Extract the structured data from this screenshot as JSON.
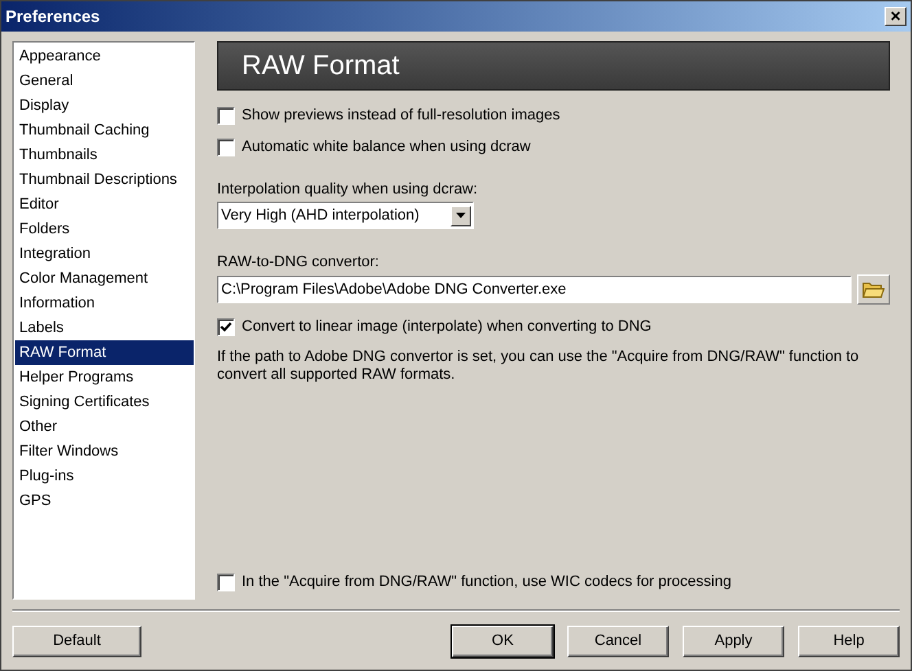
{
  "window": {
    "title": "Preferences",
    "close": "×"
  },
  "categories": [
    {
      "label": "Appearance",
      "selected": false
    },
    {
      "label": "General",
      "selected": false
    },
    {
      "label": "Display",
      "selected": false
    },
    {
      "label": "Thumbnail Caching",
      "selected": false
    },
    {
      "label": "Thumbnails",
      "selected": false
    },
    {
      "label": "Thumbnail Descriptions",
      "selected": false
    },
    {
      "label": "Editor",
      "selected": false
    },
    {
      "label": "Folders",
      "selected": false
    },
    {
      "label": "Integration",
      "selected": false
    },
    {
      "label": "Color Management",
      "selected": false
    },
    {
      "label": "Information",
      "selected": false
    },
    {
      "label": "Labels",
      "selected": false
    },
    {
      "label": "RAW Format",
      "selected": true
    },
    {
      "label": "Helper Programs",
      "selected": false
    },
    {
      "label": "Signing Certificates",
      "selected": false
    },
    {
      "label": "Other",
      "selected": false
    },
    {
      "label": "Filter Windows",
      "selected": false
    },
    {
      "label": "Plug-ins",
      "selected": false
    },
    {
      "label": "GPS",
      "selected": false
    }
  ],
  "panel": {
    "heading": "RAW Format",
    "options": [
      {
        "kind": "checkbox",
        "label": "Show previews instead of full-resolution images",
        "checked": false
      },
      {
        "kind": "checkbox",
        "label": "Automatic white balance when using dcraw",
        "checked": false
      },
      {
        "kind": "dropdown",
        "label": "Interpolation quality when using dcraw:",
        "value": "Very High (AHD interpolation)"
      },
      {
        "kind": "path",
        "label": "RAW-to-DNG convertor:",
        "value": "C:\\Program Files\\Adobe\\Adobe DNG Converter.exe"
      },
      {
        "kind": "checkbox",
        "label": "Convert to linear image (interpolate) when converting to DNG",
        "checked": true
      },
      {
        "kind": "note",
        "label": "If the path to Adobe DNG convertor is set, you can use the \"Acquire from DNG/RAW\" function to convert all supported RAW formats."
      }
    ],
    "bottom_option": {
      "label": "In the \"Acquire from DNG/RAW\" function, use WIC codecs for processing",
      "checked": false
    }
  },
  "buttons": [
    {
      "label": "Default",
      "is_default": false
    },
    {
      "label": "OK",
      "is_default": true
    },
    {
      "label": "Cancel",
      "is_default": false
    },
    {
      "label": "Apply",
      "is_default": false
    },
    {
      "label": "Help",
      "is_default": false
    }
  ]
}
